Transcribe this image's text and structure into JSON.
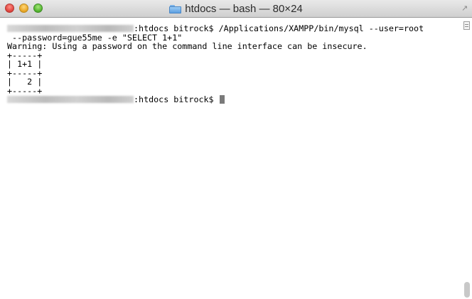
{
  "window": {
    "title": "htdocs — bash — 80×24",
    "folder_icon": "folder-icon",
    "resize_icon": "↗"
  },
  "terminal": {
    "lines": [
      ":htdocs bitrock$ /Applications/XAMPP/bin/mysql --user=root",
      " --password=gue55me -e \"SELECT 1+1\"",
      "Warning: Using a password on the command line interface can be insecure.",
      "+-----+",
      "| 1+1 |",
      "+-----+",
      "|   2 |",
      "+-----+",
      ":htdocs bitrock$ "
    ],
    "cursor_color": "#7a7a7a"
  },
  "colors": {
    "close": "#e0443e",
    "minimize": "#e9a726",
    "maximize": "#54b52f"
  }
}
